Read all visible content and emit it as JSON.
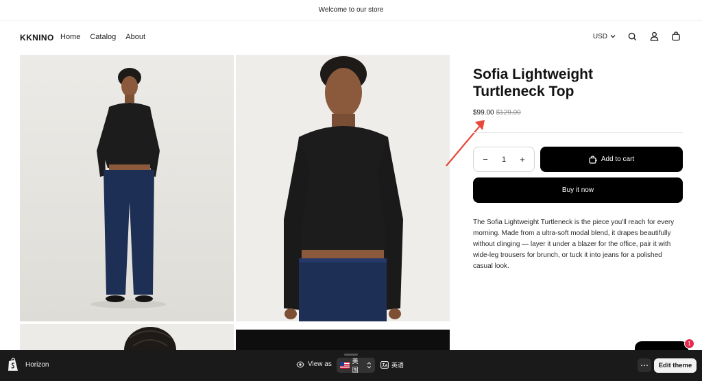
{
  "announcement": {
    "text": "Welcome to our store"
  },
  "header": {
    "logo": "KKNINO",
    "nav": [
      {
        "label": "Home"
      },
      {
        "label": "Catalog"
      },
      {
        "label": "About"
      }
    ],
    "currency": "USD",
    "icons": [
      "search-icon",
      "account-icon",
      "cart-icon"
    ]
  },
  "gallery": {
    "images": [
      "full-body model photo",
      "close-up model photo",
      "detail photo",
      "fabric detail photo"
    ],
    "colors": {
      "background_light": "#e7e6e2",
      "garment": "#1c1c1c",
      "denim": "#1d2f55"
    }
  },
  "product": {
    "title_line1": "Sofia Lightweight",
    "title_line2": "Turtleneck Top",
    "price": "$99.00",
    "compare_price": "$129.00",
    "quantity": "1",
    "add_to_cart_label": "Add to cart",
    "buy_now_label": "Buy it now",
    "description": "The Sofia Lightweight Turtleneck is the piece you'll reach for every morning. Made from a ultra-soft modal blend, it drapes beautifully without clinging — layer it under a blazer for the office, pair it with wide-leg trousers for brunch, or tuck it into jeans for a polished casual look.",
    "annotation_arrow_color": "#e8473a"
  },
  "chat": {
    "badge_count": "1"
  },
  "admin_bar": {
    "theme_name": "Horizon",
    "view_as_label": "View as",
    "country": "美国",
    "language": "英语",
    "edit_theme_label": "Edit theme",
    "bar_color": "#1a1a1a"
  }
}
